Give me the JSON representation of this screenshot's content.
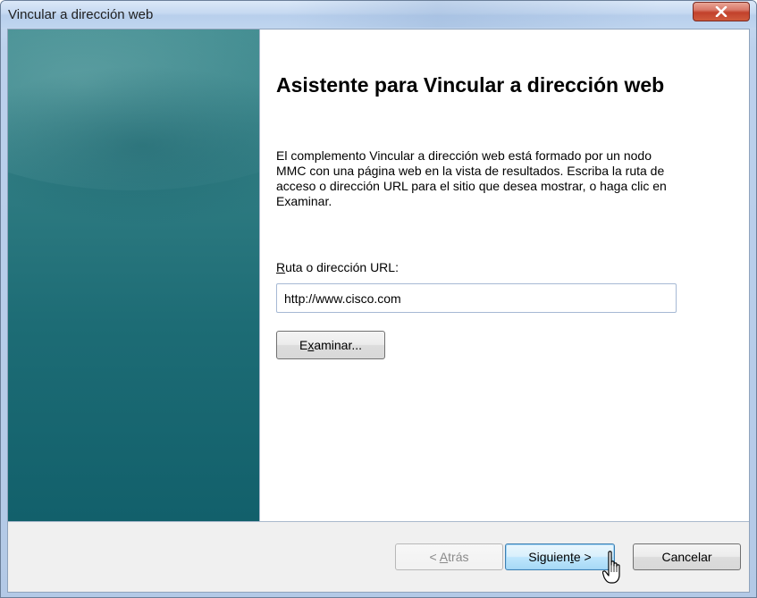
{
  "window": {
    "title": "Vincular a dirección web"
  },
  "wizard": {
    "heading": "Asistente para Vincular a dirección web",
    "description": "El complemento Vincular a dirección web está formado por un nodo MMC con una página web en la vista de resultados. Escriba la ruta de acceso o dirección URL para el sitio que desea mostrar, o haga clic en Examinar.",
    "field_label": "Ruta o dirección URL:",
    "url_value": "http://www.cisco.com",
    "browse_label": "Examinar..."
  },
  "buttons": {
    "back": "< Atrás",
    "next": "Siguiente >",
    "cancel": "Cancelar"
  },
  "icons": {
    "close": "close-icon",
    "pointer": "hand-pointer-icon"
  },
  "colors": {
    "accent_panel": "#1d6c75",
    "close_button": "#c2412b",
    "primary_button_border": "#3c7fb1"
  }
}
